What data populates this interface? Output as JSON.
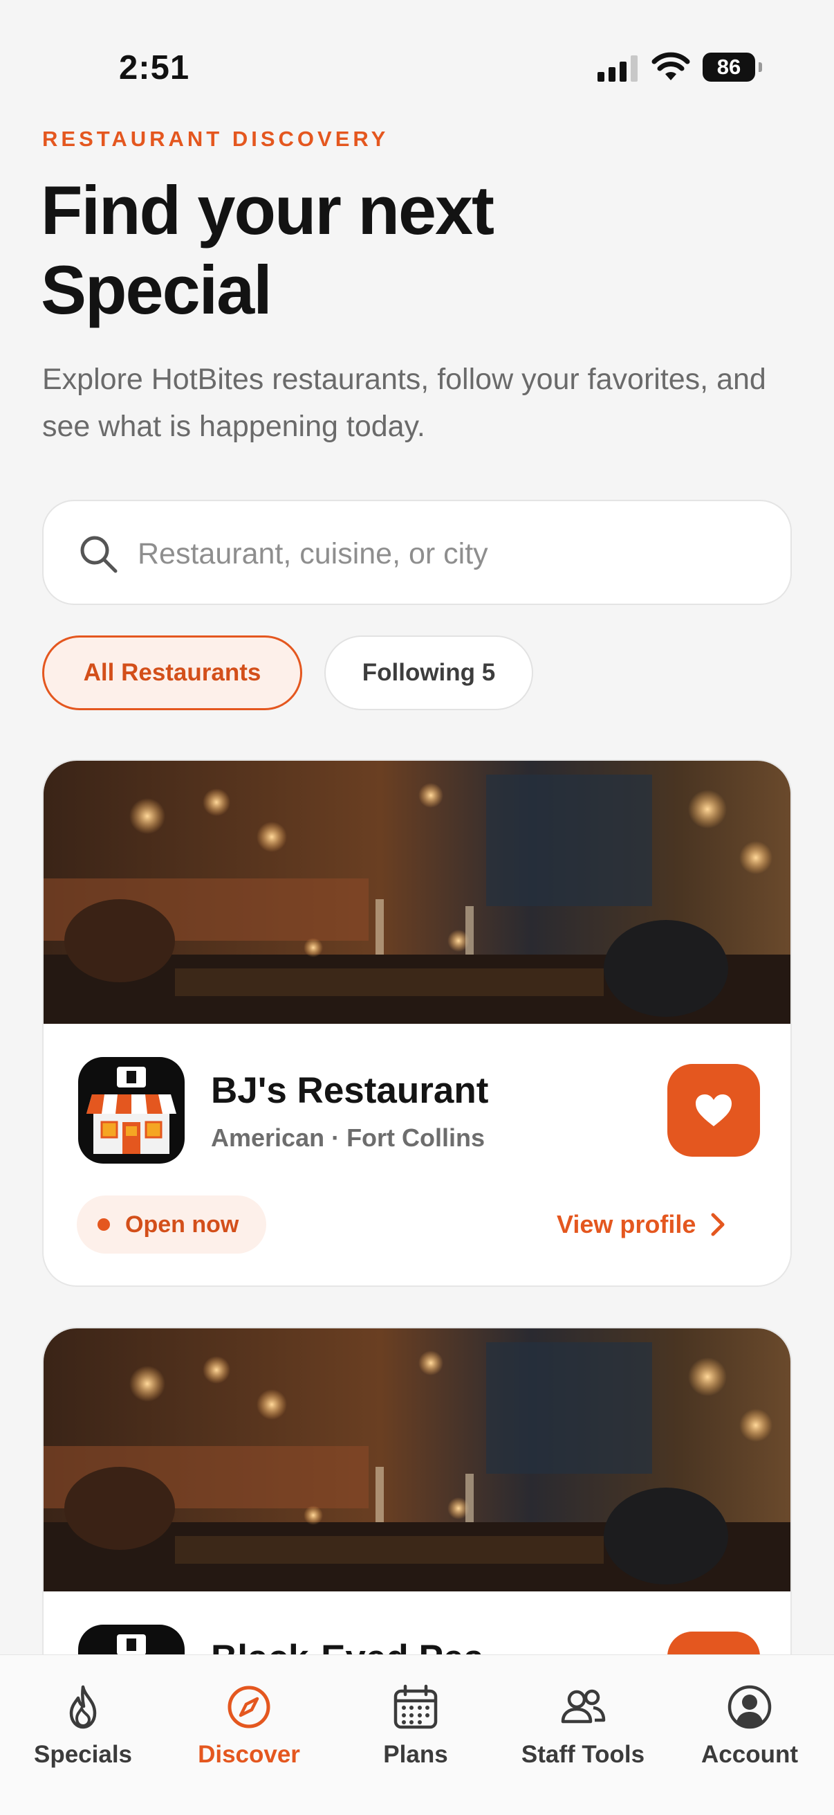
{
  "status_bar": {
    "time": "2:51",
    "battery": "86"
  },
  "header": {
    "eyebrow": "RESTAURANT DISCOVERY",
    "title": "Find your next Special",
    "subtitle": "Explore HotBites restaurants, follow your favorites, and see what is happening today."
  },
  "search": {
    "placeholder": "Restaurant, cuisine, or city",
    "value": ""
  },
  "filters": [
    {
      "label": "All Restaurants",
      "selected": true
    },
    {
      "label": "Following 5",
      "selected": false
    }
  ],
  "restaurants": [
    {
      "name": "BJ's Restaurant",
      "meta": "American · Fort Collins",
      "status": "Open now",
      "action": "View profile",
      "favorited": true
    },
    {
      "name": "Black-Eyed Pea",
      "favorited": true
    }
  ],
  "tabs": [
    {
      "label": "Specials",
      "icon": "flame-icon",
      "active": false
    },
    {
      "label": "Discover",
      "icon": "compass-icon",
      "active": true
    },
    {
      "label": "Plans",
      "icon": "calendar-icon",
      "active": false
    },
    {
      "label": "Staff Tools",
      "icon": "people-icon",
      "active": false
    },
    {
      "label": "Account",
      "icon": "person-circle-icon",
      "active": false
    }
  ],
  "colors": {
    "accent": "#e4571f",
    "accent_soft": "#fdf0ea",
    "background": "#f5f5f5"
  }
}
